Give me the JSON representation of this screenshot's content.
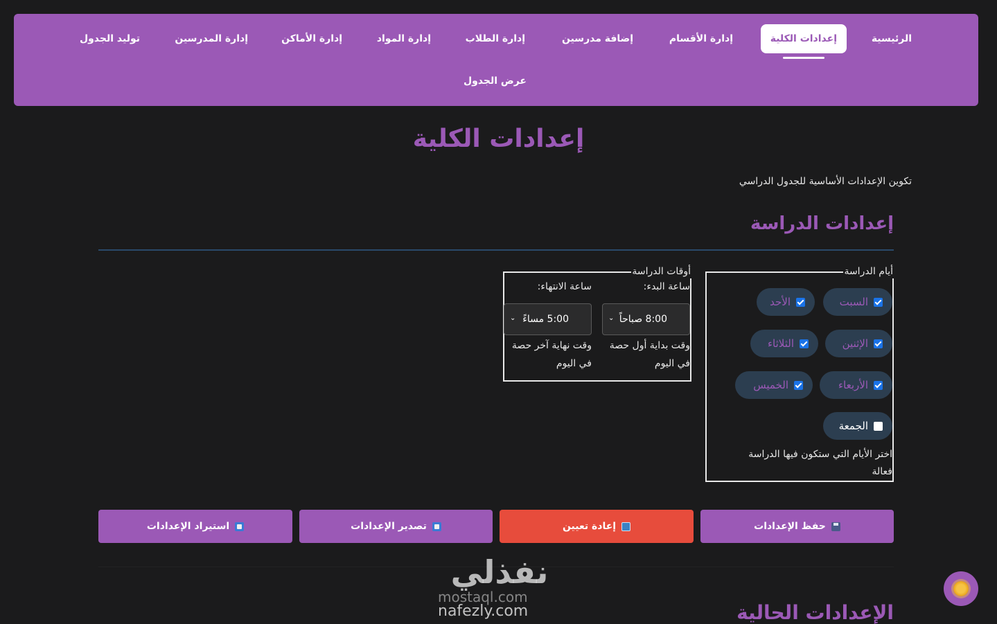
{
  "nav": {
    "items": [
      {
        "label": "الرئيسية",
        "active": false
      },
      {
        "label": "إعدادات الكلية",
        "active": true
      },
      {
        "label": "إدارة الأقسام",
        "active": false
      },
      {
        "label": "إضافة مدرسين",
        "active": false
      },
      {
        "label": "إدارة الطلاب",
        "active": false
      },
      {
        "label": "إدارة المواد",
        "active": false
      },
      {
        "label": "إدارة الأماكن",
        "active": false
      },
      {
        "label": "إدارة المدرسين",
        "active": false
      },
      {
        "label": "توليد الجدول",
        "active": false
      },
      {
        "label": "عرض الجدول",
        "active": false
      }
    ]
  },
  "page": {
    "title": "إعدادات الكلية",
    "subtitle": "تكوين الإعدادات الأساسية للجدول الدراسي"
  },
  "study_settings": {
    "section_title": "إعدادات الدراسة",
    "days": {
      "legend": "أيام الدراسة",
      "items": [
        {
          "label": "السبت",
          "checked": true
        },
        {
          "label": "الأحد",
          "checked": true
        },
        {
          "label": "الإثنين",
          "checked": true
        },
        {
          "label": "الثلاثاء",
          "checked": true
        },
        {
          "label": "الأربعاء",
          "checked": true
        },
        {
          "label": "الخميس",
          "checked": true
        },
        {
          "label": "الجمعة",
          "checked": false
        }
      ],
      "help": "اختر الأيام التي ستكون فيها الدراسة فعالة"
    },
    "times": {
      "legend": "أوقات الدراسة",
      "start_label": "ساعة البدء:",
      "start_value": "8:00 صباحاً",
      "start_help": "وقت بداية أول حصة في اليوم",
      "end_label": "ساعة الانتهاء:",
      "end_value": "5:00 مساءً",
      "end_help": "وقت نهاية آخر حصة في اليوم"
    }
  },
  "actions": {
    "save": "حفظ الإعدادات",
    "reset": "إعادة تعيين",
    "export": "تصدير الإعدادات",
    "import": "استيراد الإعدادات"
  },
  "current_settings": {
    "title": "الإعدادات الحالية"
  },
  "watermark": {
    "script": "نفذلي",
    "line1": "mostaql.com",
    "line2": "nafezly.com"
  },
  "colors": {
    "accent": "#9b59b6",
    "danger": "#e74c3c",
    "background": "#1b1b1c",
    "chip": "#2c3e50",
    "checkbox": "#1a73e8"
  },
  "icons": {
    "save": "floppy-disk-icon",
    "reset": "refresh-icon",
    "export": "outbox-icon",
    "import": "inbox-icon",
    "fab": "sun-icon",
    "select": "chevron-down-icon"
  }
}
